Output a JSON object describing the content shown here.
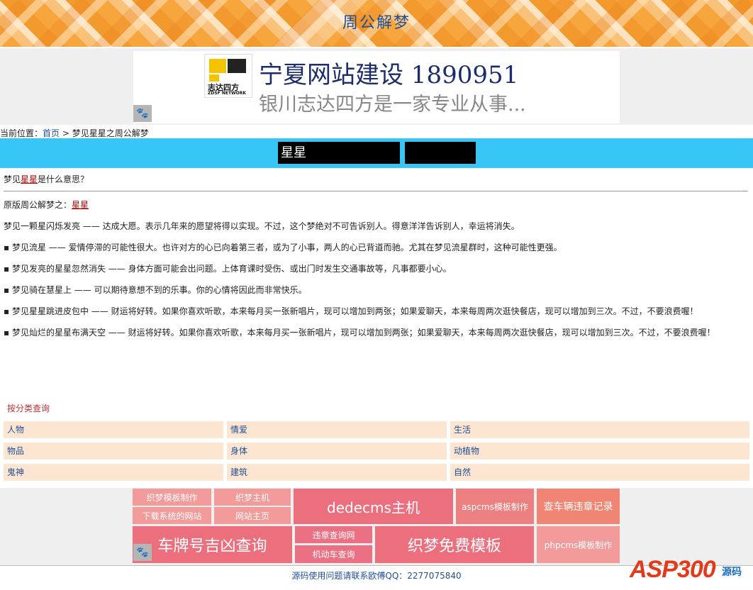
{
  "header": {
    "site_title": "周公解梦"
  },
  "ad": {
    "logo_cn": "志达四方",
    "logo_en": "ZDSF NETWORK",
    "headline": "宁夏网站建设  1890951",
    "subline": "银川志达四方是一家专业从事..."
  },
  "breadcrumb": {
    "prefix": "当前位置：",
    "home": "首页",
    "sep": " > ",
    "current": "梦见星星之周公解梦"
  },
  "keyword_bar": {
    "box1": "星星",
    "box2": ""
  },
  "article": {
    "question_pre": "梦见",
    "question_kw": "星星",
    "question_post": "是什么意思？",
    "source_pre": "原版周公解梦之：",
    "source_kw": "星星",
    "paragraphs": [
      "梦见一颗星闪烁发亮 —— 达成大愿。表示几年来的愿望将得以实现。不过，这个梦绝对不可告诉别人。得意洋洋告诉别人，幸运将消失。",
      "▪ 梦见流星 —— 爱情停滞的可能性很大。也许对方的心已向着第三者，或为了小事，两人的心已背道而驰。尤其在梦见流星群时，这种可能性更强。",
      "▪ 梦见发亮的星星忽然消失 —— 身体方面可能会出问题。上体育课时受伤、或出门时发生交通事故等，凡事都要小心。",
      "▪ 梦见骑在慧星上 —— 可以期待意想不到的乐事。你的心情将因此而非常快乐。",
      "▪ 梦见星星跳进皮包中 —— 财运将好转。如果你喜欢听歌，本来每月买一张新唱片，现可以增加到两张；如果爱聊天，本来每周两次逛快餐店，现可以增加到三次。不过，不要浪费喔！",
      "▪ 梦见灿烂的星星布满天空 —— 财运将好转。如果你喜欢听歌，本来每月买一张新唱片，现可以增加到两张；如果爱聊天，本来每周两次逛快餐店，现可以增加到三次。不过，不要浪费喔！"
    ]
  },
  "categories": {
    "title": "按分类查询",
    "items": [
      "人物",
      "情爱",
      "生活",
      "物品",
      "身体",
      "动植物",
      "鬼神",
      "建筑",
      "自然"
    ]
  },
  "bottom_links": [
    "织梦模板制作",
    "织梦主机",
    "下载系统的网站",
    "网站主页",
    "dedecms主机",
    "aspcms模板制作",
    "查车辆违章记录",
    "车牌号吉凶查询",
    "违章查询网",
    "机动车查询",
    "织梦免费模板",
    "phpcms模板制作"
  ],
  "footer": {
    "text": "源码使用问题请联系欧傅QQ：2277075840"
  },
  "watermark": {
    "brand": "ASP300",
    "cn": "源码"
  },
  "colors": {
    "accent_blue": "#37c6f6",
    "link": "#1f4f96",
    "keyword_red": "#cc0000",
    "category_bg": "#fde6d1"
  }
}
